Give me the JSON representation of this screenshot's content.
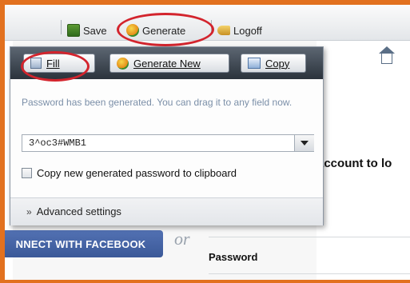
{
  "toolbar": {
    "save_label": "Save",
    "generate_label": "Generate",
    "logoff_label": "Logoff"
  },
  "popup": {
    "buttons": {
      "fill_label": "Fill",
      "generate_new_label": "Generate New",
      "copy_label": "Copy"
    },
    "message": "Password has been generated. You can drag it to any field now.",
    "generated_password": "3^oc3#WMB1",
    "copy_checkbox_label": "Copy new generated password to clipboard",
    "advanced_label": "Advanced settings"
  },
  "page": {
    "heading_fragment": "account to lo",
    "facebook_button_label": "NNECT WITH FACEBOOK",
    "or_label": "or",
    "password_label": "Password"
  },
  "colors": {
    "frame_border": "#e2711f",
    "highlight_ring": "#d3242d",
    "facebook_blue": "#3b5998",
    "popup_bar": "#2b333c"
  }
}
